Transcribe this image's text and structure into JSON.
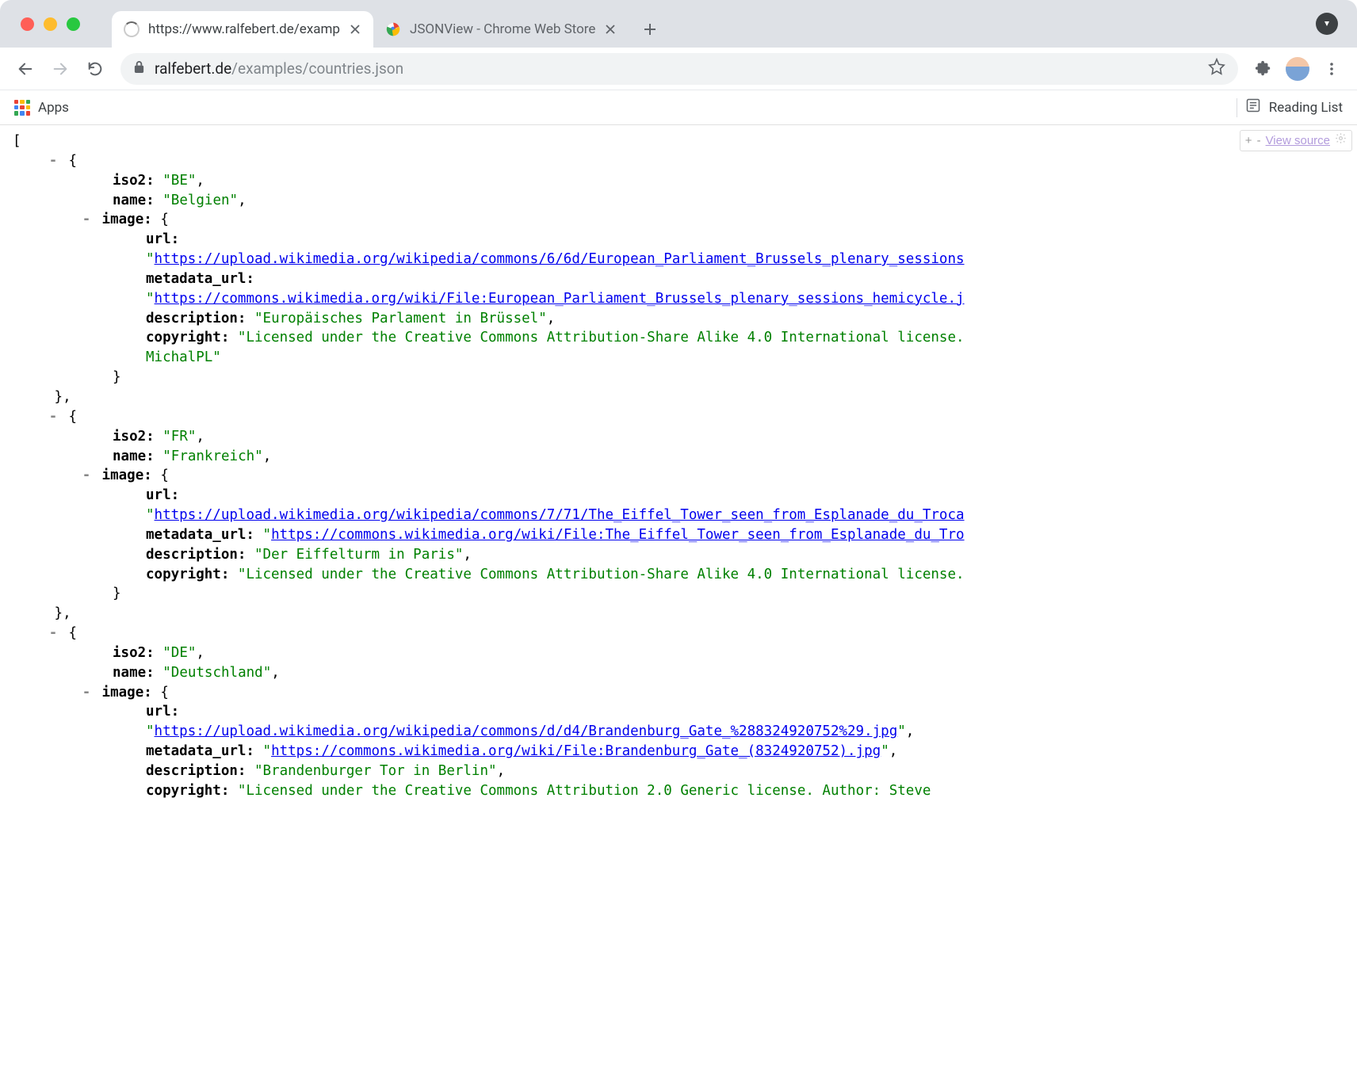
{
  "tabs": [
    {
      "title": "https://www.ralfebert.de/examp"
    },
    {
      "title": "JSONView - Chrome Web Store"
    }
  ],
  "omnibox": {
    "host": "ralfebert.de",
    "path": "/examples/countries.json"
  },
  "bookmarks": {
    "apps": "Apps",
    "reading_list": "Reading List"
  },
  "jsonview_bar": {
    "plus": "+",
    "minus": "-",
    "view_source": "View source"
  },
  "json": {
    "items": [
      {
        "iso2": "BE",
        "name": "Belgien",
        "image": {
          "url": "https://upload.wikimedia.org/wikipedia/commons/6/6d/European_Parliament_Brussels_plenary_sessions",
          "metadata_url": "https://commons.wikimedia.org/wiki/File:European_Parliament_Brussels_plenary_sessions_hemicycle.j",
          "description": "Europäisches Parlament in Brüssel",
          "copyright_line1": "Licensed under the Creative Commons Attribution-Share Alike 4.0 International license.",
          "copyright_line2": "MichalPL"
        }
      },
      {
        "iso2": "FR",
        "name": "Frankreich",
        "image": {
          "url": "https://upload.wikimedia.org/wikipedia/commons/7/71/The_Eiffel_Tower_seen_from_Esplanade_du_Troca",
          "metadata_url": "https://commons.wikimedia.org/wiki/File:The_Eiffel_Tower_seen_from_Esplanade_du_Tro",
          "description": "Der Eiffelturm in Paris",
          "copyright_line1": "Licensed under the Creative Commons Attribution-Share Alike 4.0 International license."
        }
      },
      {
        "iso2": "DE",
        "name": "Deutschland",
        "image": {
          "url": "https://upload.wikimedia.org/wikipedia/commons/d/d4/Brandenburg_Gate_%288324920752%29.jpg",
          "metadata_url": "https://commons.wikimedia.org/wiki/File:Brandenburg_Gate_(8324920752).jpg",
          "description": "Brandenburger Tor in Berlin",
          "copyright_line1": "Licensed under the Creative Commons Attribution 2.0 Generic license. Author: Steve"
        }
      }
    ]
  },
  "labels": {
    "iso2": "iso2:",
    "name": "name:",
    "image": "image:",
    "url": "url:",
    "metadata_url": "metadata_url:",
    "description": "description:",
    "copyright": "copyright:"
  }
}
